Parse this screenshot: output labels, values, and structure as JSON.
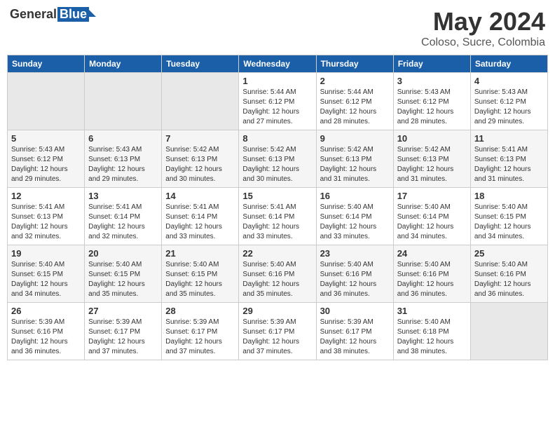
{
  "logo": {
    "general": "General",
    "blue": "Blue"
  },
  "title": {
    "month_year": "May 2024",
    "location": "Coloso, Sucre, Colombia"
  },
  "headers": [
    "Sunday",
    "Monday",
    "Tuesday",
    "Wednesday",
    "Thursday",
    "Friday",
    "Saturday"
  ],
  "weeks": [
    [
      {
        "day": "",
        "info": ""
      },
      {
        "day": "",
        "info": ""
      },
      {
        "day": "",
        "info": ""
      },
      {
        "day": "1",
        "info": "Sunrise: 5:44 AM\nSunset: 6:12 PM\nDaylight: 12 hours\nand 27 minutes."
      },
      {
        "day": "2",
        "info": "Sunrise: 5:44 AM\nSunset: 6:12 PM\nDaylight: 12 hours\nand 28 minutes."
      },
      {
        "day": "3",
        "info": "Sunrise: 5:43 AM\nSunset: 6:12 PM\nDaylight: 12 hours\nand 28 minutes."
      },
      {
        "day": "4",
        "info": "Sunrise: 5:43 AM\nSunset: 6:12 PM\nDaylight: 12 hours\nand 29 minutes."
      }
    ],
    [
      {
        "day": "5",
        "info": "Sunrise: 5:43 AM\nSunset: 6:12 PM\nDaylight: 12 hours\nand 29 minutes."
      },
      {
        "day": "6",
        "info": "Sunrise: 5:43 AM\nSunset: 6:13 PM\nDaylight: 12 hours\nand 29 minutes."
      },
      {
        "day": "7",
        "info": "Sunrise: 5:42 AM\nSunset: 6:13 PM\nDaylight: 12 hours\nand 30 minutes."
      },
      {
        "day": "8",
        "info": "Sunrise: 5:42 AM\nSunset: 6:13 PM\nDaylight: 12 hours\nand 30 minutes."
      },
      {
        "day": "9",
        "info": "Sunrise: 5:42 AM\nSunset: 6:13 PM\nDaylight: 12 hours\nand 31 minutes."
      },
      {
        "day": "10",
        "info": "Sunrise: 5:42 AM\nSunset: 6:13 PM\nDaylight: 12 hours\nand 31 minutes."
      },
      {
        "day": "11",
        "info": "Sunrise: 5:41 AM\nSunset: 6:13 PM\nDaylight: 12 hours\nand 31 minutes."
      }
    ],
    [
      {
        "day": "12",
        "info": "Sunrise: 5:41 AM\nSunset: 6:13 PM\nDaylight: 12 hours\nand 32 minutes."
      },
      {
        "day": "13",
        "info": "Sunrise: 5:41 AM\nSunset: 6:14 PM\nDaylight: 12 hours\nand 32 minutes."
      },
      {
        "day": "14",
        "info": "Sunrise: 5:41 AM\nSunset: 6:14 PM\nDaylight: 12 hours\nand 33 minutes."
      },
      {
        "day": "15",
        "info": "Sunrise: 5:41 AM\nSunset: 6:14 PM\nDaylight: 12 hours\nand 33 minutes."
      },
      {
        "day": "16",
        "info": "Sunrise: 5:40 AM\nSunset: 6:14 PM\nDaylight: 12 hours\nand 33 minutes."
      },
      {
        "day": "17",
        "info": "Sunrise: 5:40 AM\nSunset: 6:14 PM\nDaylight: 12 hours\nand 34 minutes."
      },
      {
        "day": "18",
        "info": "Sunrise: 5:40 AM\nSunset: 6:15 PM\nDaylight: 12 hours\nand 34 minutes."
      }
    ],
    [
      {
        "day": "19",
        "info": "Sunrise: 5:40 AM\nSunset: 6:15 PM\nDaylight: 12 hours\nand 34 minutes."
      },
      {
        "day": "20",
        "info": "Sunrise: 5:40 AM\nSunset: 6:15 PM\nDaylight: 12 hours\nand 35 minutes."
      },
      {
        "day": "21",
        "info": "Sunrise: 5:40 AM\nSunset: 6:15 PM\nDaylight: 12 hours\nand 35 minutes."
      },
      {
        "day": "22",
        "info": "Sunrise: 5:40 AM\nSunset: 6:16 PM\nDaylight: 12 hours\nand 35 minutes."
      },
      {
        "day": "23",
        "info": "Sunrise: 5:40 AM\nSunset: 6:16 PM\nDaylight: 12 hours\nand 36 minutes."
      },
      {
        "day": "24",
        "info": "Sunrise: 5:40 AM\nSunset: 6:16 PM\nDaylight: 12 hours\nand 36 minutes."
      },
      {
        "day": "25",
        "info": "Sunrise: 5:40 AM\nSunset: 6:16 PM\nDaylight: 12 hours\nand 36 minutes."
      }
    ],
    [
      {
        "day": "26",
        "info": "Sunrise: 5:39 AM\nSunset: 6:16 PM\nDaylight: 12 hours\nand 36 minutes."
      },
      {
        "day": "27",
        "info": "Sunrise: 5:39 AM\nSunset: 6:17 PM\nDaylight: 12 hours\nand 37 minutes."
      },
      {
        "day": "28",
        "info": "Sunrise: 5:39 AM\nSunset: 6:17 PM\nDaylight: 12 hours\nand 37 minutes."
      },
      {
        "day": "29",
        "info": "Sunrise: 5:39 AM\nSunset: 6:17 PM\nDaylight: 12 hours\nand 37 minutes."
      },
      {
        "day": "30",
        "info": "Sunrise: 5:39 AM\nSunset: 6:17 PM\nDaylight: 12 hours\nand 38 minutes."
      },
      {
        "day": "31",
        "info": "Sunrise: 5:40 AM\nSunset: 6:18 PM\nDaylight: 12 hours\nand 38 minutes."
      },
      {
        "day": "",
        "info": ""
      }
    ]
  ]
}
